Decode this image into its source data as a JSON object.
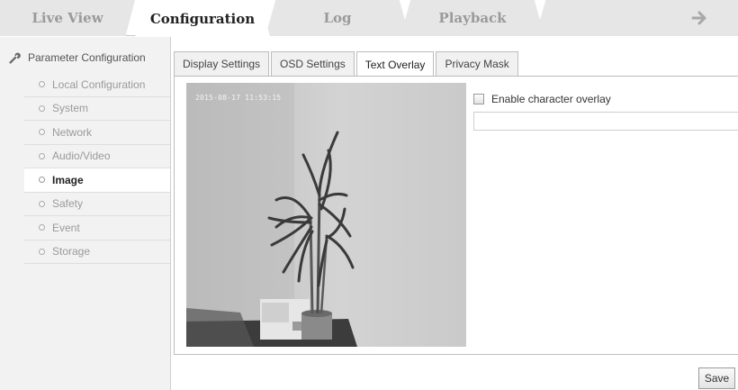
{
  "top_tabs": [
    {
      "label": "Live View",
      "active": false
    },
    {
      "label": "Configuration",
      "active": true
    },
    {
      "label": "Log",
      "active": false
    },
    {
      "label": "Playback",
      "active": false
    }
  ],
  "logout_icon": "arrow-right-icon",
  "sidebar": {
    "header": {
      "label": "Parameter Configuration",
      "icon": "wrench-icon"
    },
    "items": [
      {
        "label": "Local Configuration",
        "active": false
      },
      {
        "label": "System",
        "active": false
      },
      {
        "label": "Network",
        "active": false
      },
      {
        "label": "Audio/Video",
        "active": false
      },
      {
        "label": "Image",
        "active": true
      },
      {
        "label": "Safety",
        "active": false
      },
      {
        "label": "Event",
        "active": false
      },
      {
        "label": "Storage",
        "active": false
      }
    ]
  },
  "subtabs": [
    {
      "label": "Display Settings",
      "active": false
    },
    {
      "label": "OSD Settings",
      "active": false
    },
    {
      "label": "Text Overlay",
      "active": true
    },
    {
      "label": "Privacy Mask",
      "active": false
    }
  ],
  "video": {
    "timestamp": "2015-08-17 11:53:15"
  },
  "text_overlay": {
    "enable_label": "Enable character overlay",
    "checked": false,
    "text_value": ""
  },
  "save_label": "Save"
}
